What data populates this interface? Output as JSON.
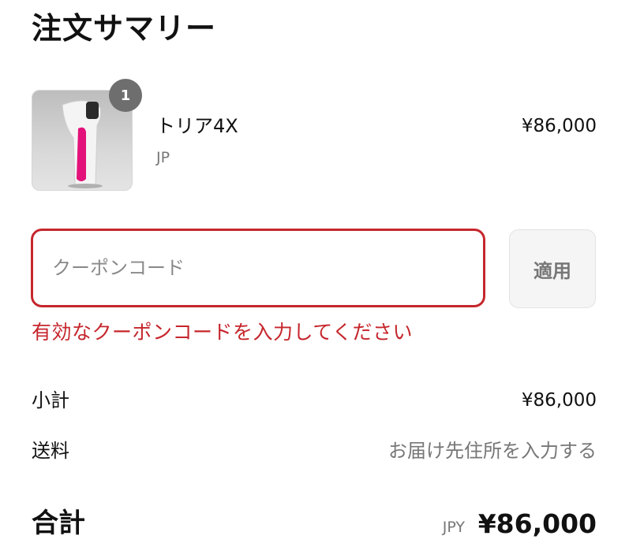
{
  "summary": {
    "title": "注文サマリー"
  },
  "product": {
    "quantity": "1",
    "name": "トリア4X",
    "variant": "JP",
    "price": "¥86,000",
    "image_icon": "hair-removal-device-image"
  },
  "coupon": {
    "placeholder": "クーポンコード",
    "value": "",
    "apply_label": "適用",
    "error": "有効なクーポンコードを入力してください",
    "error_color": "#c5262c"
  },
  "totals": {
    "subtotal_label": "小計",
    "subtotal_value": "¥86,000",
    "shipping_label": "送料",
    "shipping_value": "お届け先住所を入力する",
    "total_label": "合計",
    "currency": "JPY",
    "total_value": "¥86,000"
  }
}
